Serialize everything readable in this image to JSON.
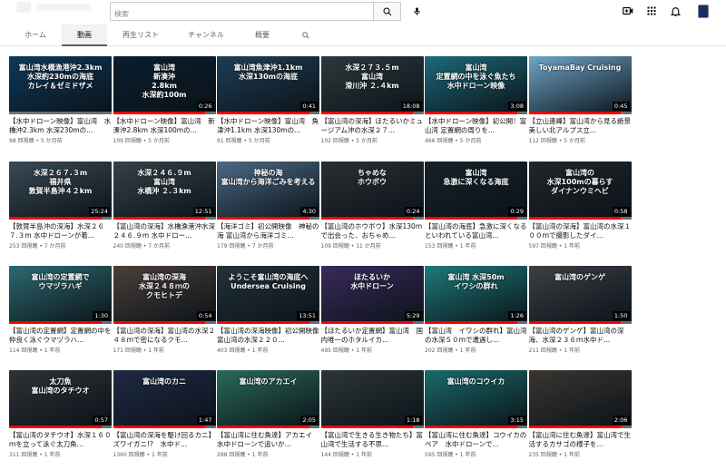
{
  "search": {
    "placeholder": "検索"
  },
  "colors": {
    "accent": "#ff0000",
    "active_tab_bg": "#f2f2f2"
  },
  "tabs": [
    {
      "label": "ホーム",
      "active": false
    },
    {
      "label": "動画",
      "active": true
    },
    {
      "label": "再生リスト",
      "active": false
    },
    {
      "label": "チャンネル",
      "active": false
    },
    {
      "label": "概要",
      "active": false
    }
  ],
  "videos": [
    {
      "thumb_text": "富山湾水橋漁港沖2.3km\n水深約230mの海底\nカレイ＆ゼミドザメ",
      "duration": "",
      "title": "【水中ドローン映像】富山湾　水橋沖2.3km 水深230mの...",
      "views": "98 回視聴",
      "age": "5 か月前",
      "bg": "#0e3a5c",
      "prog": 0
    },
    {
      "thumb_text": "富山湾\n新湊沖\n2.8km\n水深約100m",
      "duration": "0:26",
      "title": "【水中ドローン映像】富山湾　新湊沖2.8km 水深100mの...",
      "views": "109 回視聴",
      "age": "5 か月前",
      "bg": "#0a1e2e",
      "prog": 0.9
    },
    {
      "thumb_text": "富山湾魚津沖1.1km\n水深130mの海底",
      "duration": "0:41",
      "title": "【水中ドローン映像】富山湾　魚津沖1.1km 水深130mの...",
      "views": "91 回視聴",
      "age": "5 か月前",
      "bg": "#1f3e55",
      "prog": 0.9
    },
    {
      "thumb_text": "水深２７３.５m\n富山湾\n滑川沖 ２.４km",
      "duration": "18:08",
      "title": "【富山湾の深海】ほたるいかミュージアム沖の水深２７...",
      "views": "102 回視聴",
      "age": "5 か月前",
      "bg": "#2b3a3d",
      "prog": 0.9
    },
    {
      "thumb_text": "富山湾\n定置網の中を泳ぐ魚たち\n水中ドローン映像",
      "duration": "3:08",
      "title": "【水中ドローン映像】初公開！富山湾 定置網の周りを...",
      "views": "466 回視聴",
      "age": "5 か月前",
      "bg": "#1c6a7a",
      "prog": 0.9
    },
    {
      "thumb_text": "ToyamaBay Cruising",
      "duration": "0:45",
      "title": "【立山連峰】富山湾から見る絶景　美しい北アルプス立...",
      "views": "112 回視聴",
      "age": "5 か月前",
      "bg": "#6fa5c9",
      "prog": 0.9
    },
    {
      "thumb_text": "水深２６７.３m\n福井県\n敦賀半島沖４２km",
      "duration": "25:24",
      "title": "【敦賀半島沖の深海】水深２６７.３m 水中ドローンが着...",
      "views": "253 回視聴",
      "age": "7 か月前",
      "bg": "#3a4a55",
      "prog": 0.9
    },
    {
      "thumb_text": "水深２４６.９m\n富山湾\n水橋沖 ２.３km",
      "duration": "12:51",
      "title": "【富山湾の深海】水橋漁港沖水深２４６.９m 水中ドロー...",
      "views": "240 回視聴",
      "age": "7 か月前",
      "bg": "#34424a",
      "prog": 0.9
    },
    {
      "thumb_text": "神秘の海\n富山湾から海洋ごみを考える",
      "duration": "4:30",
      "title": "【海洋ゴミ】初公開映像　神秘の海 富山湾から海洋ゴミ...",
      "views": "179 回視聴",
      "age": "7 か月前",
      "bg": "#4c6a85",
      "prog": 0.9
    },
    {
      "thumb_text": "ちゃめな\nホウボウ",
      "duration": "0:24",
      "title": "【富山湾のホウボウ】水深130mで出会った、おちゃめ...",
      "views": "109 回視聴",
      "age": "11 か月前",
      "bg": "#2a2f33",
      "prog": 0.9
    },
    {
      "thumb_text": "富山湾\n急激に深くなる海底",
      "duration": "0:29",
      "title": "【富山湾の海底】急激に深くなるといわれている富山湾...",
      "views": "153 回視聴",
      "age": "1 年前",
      "bg": "#15222a",
      "prog": 0.9
    },
    {
      "thumb_text": "富山湾の\n水深100mの暮らす\nダイナンウミヘビ",
      "duration": "0:58",
      "title": "【富山湾の深海】富山湾の水深１００ｍで撮影したダイ...",
      "views": "597 回視聴",
      "age": "1 年前",
      "bg": "#20272b",
      "prog": 0.9
    },
    {
      "thumb_text": "富山湾の定置網で\nウマヅラハギ",
      "duration": "1:30",
      "title": "【富山湾の定置網】定置網の中を仲良く泳ぐウマヅラハ...",
      "views": "114 回視聴",
      "age": "1 年前",
      "bg": "#2c6a70",
      "prog": 0.9
    },
    {
      "thumb_text": "富山湾の深海\n水深２４８ｍの\nクモヒトデ",
      "duration": "0:54",
      "title": "【富山湾の深海】富山湾の水深２４８ｍで密になるクモ...",
      "views": "171 回視聴",
      "age": "1 年前",
      "bg": "#4a3f3a",
      "prog": 0.9
    },
    {
      "thumb_text": "ようこそ富山湾の海底へ\nUndersea Cruising",
      "duration": "13:51",
      "title": "【富山湾の深海映像】初公開映像　富山湾の水深２２０...",
      "views": "403 回視聴",
      "age": "1 年前",
      "bg": "#22323c",
      "prog": 0.9
    },
    {
      "thumb_text": "ほたるいか\n水中ドローン",
      "duration": "5:29",
      "title": "【ほたるいか定置網】富山湾　国内唯一のホタルイカ...",
      "views": "495 回視聴",
      "age": "1 年前",
      "bg": "#3a2a5c",
      "prog": 0.9
    },
    {
      "thumb_text": "富山湾 水深50m\nイワシの群れ",
      "duration": "1:26",
      "title": "【富山湾　イワシの群れ】富山湾の水深５０ｍで遭遇し...",
      "views": "202 回視聴",
      "age": "1 年前",
      "bg": "#1e7a7a",
      "prog": 0.9
    },
    {
      "thumb_text": "富山湾のゲンゲ",
      "duration": "1:50",
      "title": "【富山湾のゲンゲ】富山湾の深海、水深２３６ｍ水中ド...",
      "views": "211 回視聴",
      "age": "1 年前",
      "bg": "#3a4044",
      "prog": 0.9
    },
    {
      "thumb_text": "太刀魚\n富山湾のタチウオ",
      "duration": "0:57",
      "title": "【富山湾のタチウオ】水深１６０ｍを立って泳ぐ太刀魚...",
      "views": "311 回視聴",
      "age": "1 年前",
      "bg": "#2d3236",
      "prog": 0.9
    },
    {
      "thumb_text": "富山湾のカニ",
      "duration": "1:47",
      "title": "【富山湾の深海を駆け回るカニ】ズワイガニ!?　水中ド...",
      "views": "1360 回視聴",
      "age": "1 年前",
      "bg": "#1e2a44",
      "prog": 0.9
    },
    {
      "thumb_text": "富山湾のアカエイ",
      "duration": "2:05",
      "title": "【富山湾に住む魚達】アカエイ　水中ドローンで追いか...",
      "views": "288 回視聴",
      "age": "1 年前",
      "bg": "#2a6a5a",
      "prog": 0.9
    },
    {
      "thumb_text": "",
      "duration": "1:18",
      "title": "【富山湾で生きる生き物たち】富山湾で生活する不思...",
      "views": "144 回視聴",
      "age": "1 年前",
      "bg": "#2c3538",
      "prog": 0.9
    },
    {
      "thumb_text": "富山湾のコウイカ",
      "duration": "3:15",
      "title": "【富山湾に住む魚達】コウイカのペア　水中ドローンで...",
      "views": "595 回視聴",
      "age": "1 年前",
      "bg": "#1b6a6a",
      "prog": 0.9
    },
    {
      "thumb_text": "",
      "duration": "2:06",
      "title": "【富山湾に住む魚達】富山湾で生活するカサゴの様子を...",
      "views": "235 回視聴",
      "age": "1 年前",
      "bg": "#3a3632",
      "prog": 0.9
    }
  ]
}
